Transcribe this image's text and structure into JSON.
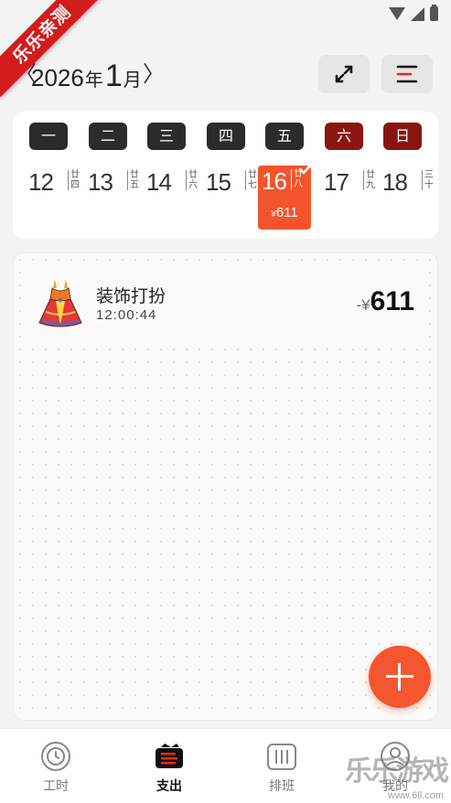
{
  "watermark": {
    "banner_text": "乐乐亲测",
    "corner_text": "乐乐游戏",
    "corner_url": "www.6ll.com"
  },
  "header": {
    "prev_label": "〈",
    "year": "2026",
    "year_suffix": "年",
    "month": "1",
    "month_suffix": "月",
    "next_label": "〉",
    "expand_icon": "expand-arrows-icon",
    "sort_icon": "sort-lines-icon"
  },
  "week": {
    "weekdays": [
      "一",
      "二",
      "三",
      "四",
      "五",
      "六",
      "日"
    ],
    "dates": [
      {
        "day": "12",
        "lunar": "廿四"
      },
      {
        "day": "13",
        "lunar": "廿五"
      },
      {
        "day": "14",
        "lunar": "廿六"
      },
      {
        "day": "15",
        "lunar": "廿七"
      },
      {
        "day": "16",
        "lunar": "廿八",
        "amount": "611"
      },
      {
        "day": "17",
        "lunar": "廿九"
      },
      {
        "day": "18",
        "lunar": "三十"
      }
    ],
    "selected_amount_prefix": "¥"
  },
  "expense": {
    "icon": "dress-icon",
    "name": "装饰打扮",
    "time": "12:00:44",
    "amount_prefix": "-¥",
    "amount": "611"
  },
  "nav": [
    {
      "label": "工时",
      "icon": "clock-icon"
    },
    {
      "label": "支出",
      "icon": "wallet-icon"
    },
    {
      "label": "排班",
      "icon": "schedule-icon"
    },
    {
      "label": "我的",
      "icon": "profile-icon"
    }
  ],
  "colors": {
    "accent": "#f4562f",
    "weekday_dark": "#2b2b2b",
    "weekend_red": "#8a1510",
    "banner_red": "#d21b1b"
  }
}
